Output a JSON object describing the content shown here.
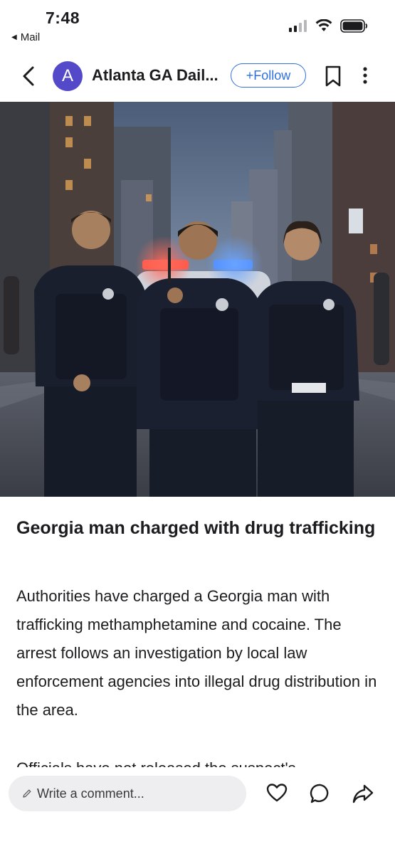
{
  "status_bar": {
    "time": "7:48",
    "back_app": "Mail"
  },
  "nav": {
    "avatar_letter": "A",
    "source_title": "Atlanta GA Dail...",
    "follow_label": "+Follow",
    "avatar_color": "#5449c9",
    "accent_color": "#2f6fde"
  },
  "article": {
    "title": "Georgia man charged with drug trafficking",
    "body": "Authorities have charged a Georgia man with trafficking methamphetamine and cocaine. The arrest follows an investigation by local law enforcement agencies into illegal drug distribution in the area.",
    "next_paragraph_partial": "Officials have not released the suspect's"
  },
  "bottom_bar": {
    "comment_placeholder": "Write a comment...",
    "icons": [
      "pencil-icon",
      "heart-icon",
      "comment-icon",
      "share-icon"
    ]
  }
}
